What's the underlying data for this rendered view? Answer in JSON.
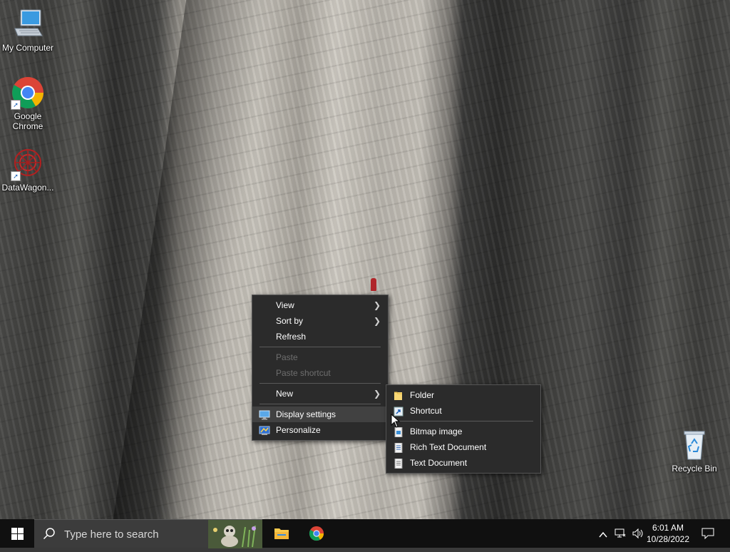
{
  "desktop": {
    "icons": [
      {
        "label": "My Computer"
      },
      {
        "label": "Google Chrome"
      },
      {
        "label": "DataWagon..."
      },
      {
        "label": "Recycle Bin"
      }
    ]
  },
  "context_menu": {
    "items": {
      "view": "View",
      "sort_by": "Sort by",
      "refresh": "Refresh",
      "paste": "Paste",
      "paste_shortcut": "Paste shortcut",
      "new": "New",
      "display_settings": "Display settings",
      "personalize": "Personalize"
    }
  },
  "new_submenu": {
    "items": {
      "folder": "Folder",
      "shortcut": "Shortcut",
      "bitmap_image": "Bitmap image",
      "rich_text_document": "Rich Text Document",
      "text_document": "Text Document"
    }
  },
  "taskbar": {
    "search_placeholder": "Type here to search",
    "time": "6:01 AM",
    "date": "10/28/2022"
  },
  "colors": {
    "menu_bg": "#2b2b2b",
    "taskbar_bg": "#101010",
    "windows_blue": "#0078d7"
  }
}
